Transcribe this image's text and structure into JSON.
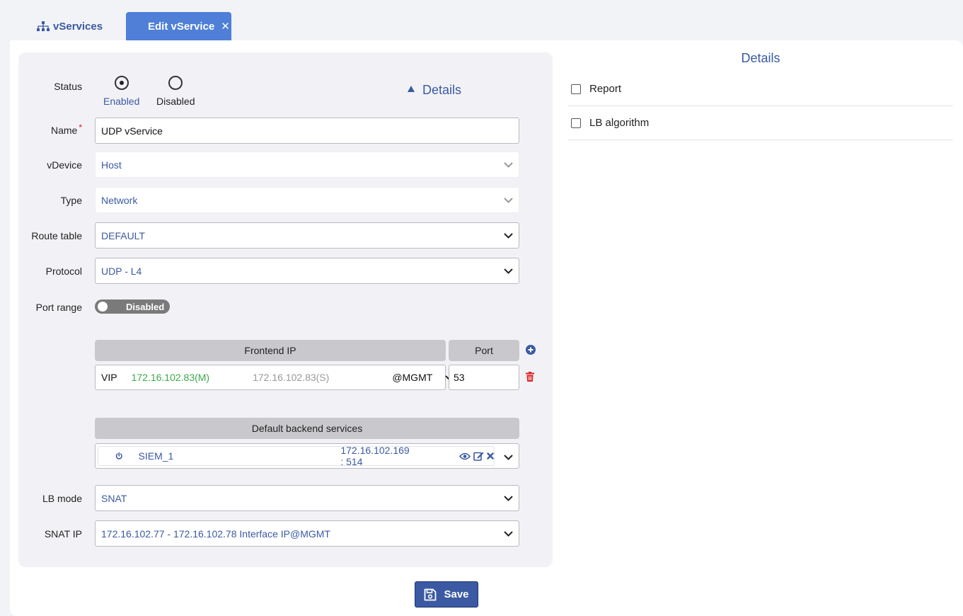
{
  "tabs": {
    "vservices_label": "vServices",
    "edit_label": "Edit vService",
    "close_symbol": "✕"
  },
  "form": {
    "status": {
      "label": "Status",
      "options": [
        "Enabled",
        "Disabled"
      ],
      "selected": "Enabled"
    },
    "details_toggle": "Details",
    "name": {
      "label": "Name",
      "required_mark": "*",
      "value": "UDP vService"
    },
    "vdevice": {
      "label": "vDevice",
      "value": "Host"
    },
    "type": {
      "label": "Type",
      "value": "Network"
    },
    "route_table": {
      "label": "Route table",
      "value": "DEFAULT"
    },
    "protocol": {
      "label": "Protocol",
      "value": "UDP - L4"
    },
    "port_range": {
      "label": "Port range",
      "state": "Disabled"
    },
    "frontend": {
      "header_ip": "Frontend IP",
      "header_port": "Port",
      "rows": [
        {
          "vip": "VIP",
          "master": "172.16.102.83(M)",
          "slave": "172.16.102.83(S)",
          "interface": "@MGMT",
          "port": "53"
        }
      ]
    },
    "backend": {
      "header": "Default backend services",
      "rows": [
        {
          "name": "SIEM_1",
          "address": "172.16.102.169 : 514"
        }
      ]
    },
    "lb_mode": {
      "label": "LB mode",
      "value": "SNAT"
    },
    "snat_ip": {
      "label": "SNAT IP",
      "value": "172.16.102.77 - 172.16.102.78 Interface IP@MGMT"
    }
  },
  "save_label": "Save",
  "right_panel": {
    "title": "Details",
    "items": [
      "Report",
      "LB algorithm"
    ]
  },
  "colors": {
    "accent": "#3b5aa3",
    "tab_active": "#4f7fd6",
    "green": "#3aab48",
    "danger": "#e02424"
  },
  "icons": [
    "sitemap-icon",
    "close-icon",
    "chevron-down-icon",
    "plus-circle-icon",
    "trash-icon",
    "power-icon",
    "eye-icon",
    "edit-icon",
    "remove-icon",
    "save-icon"
  ]
}
